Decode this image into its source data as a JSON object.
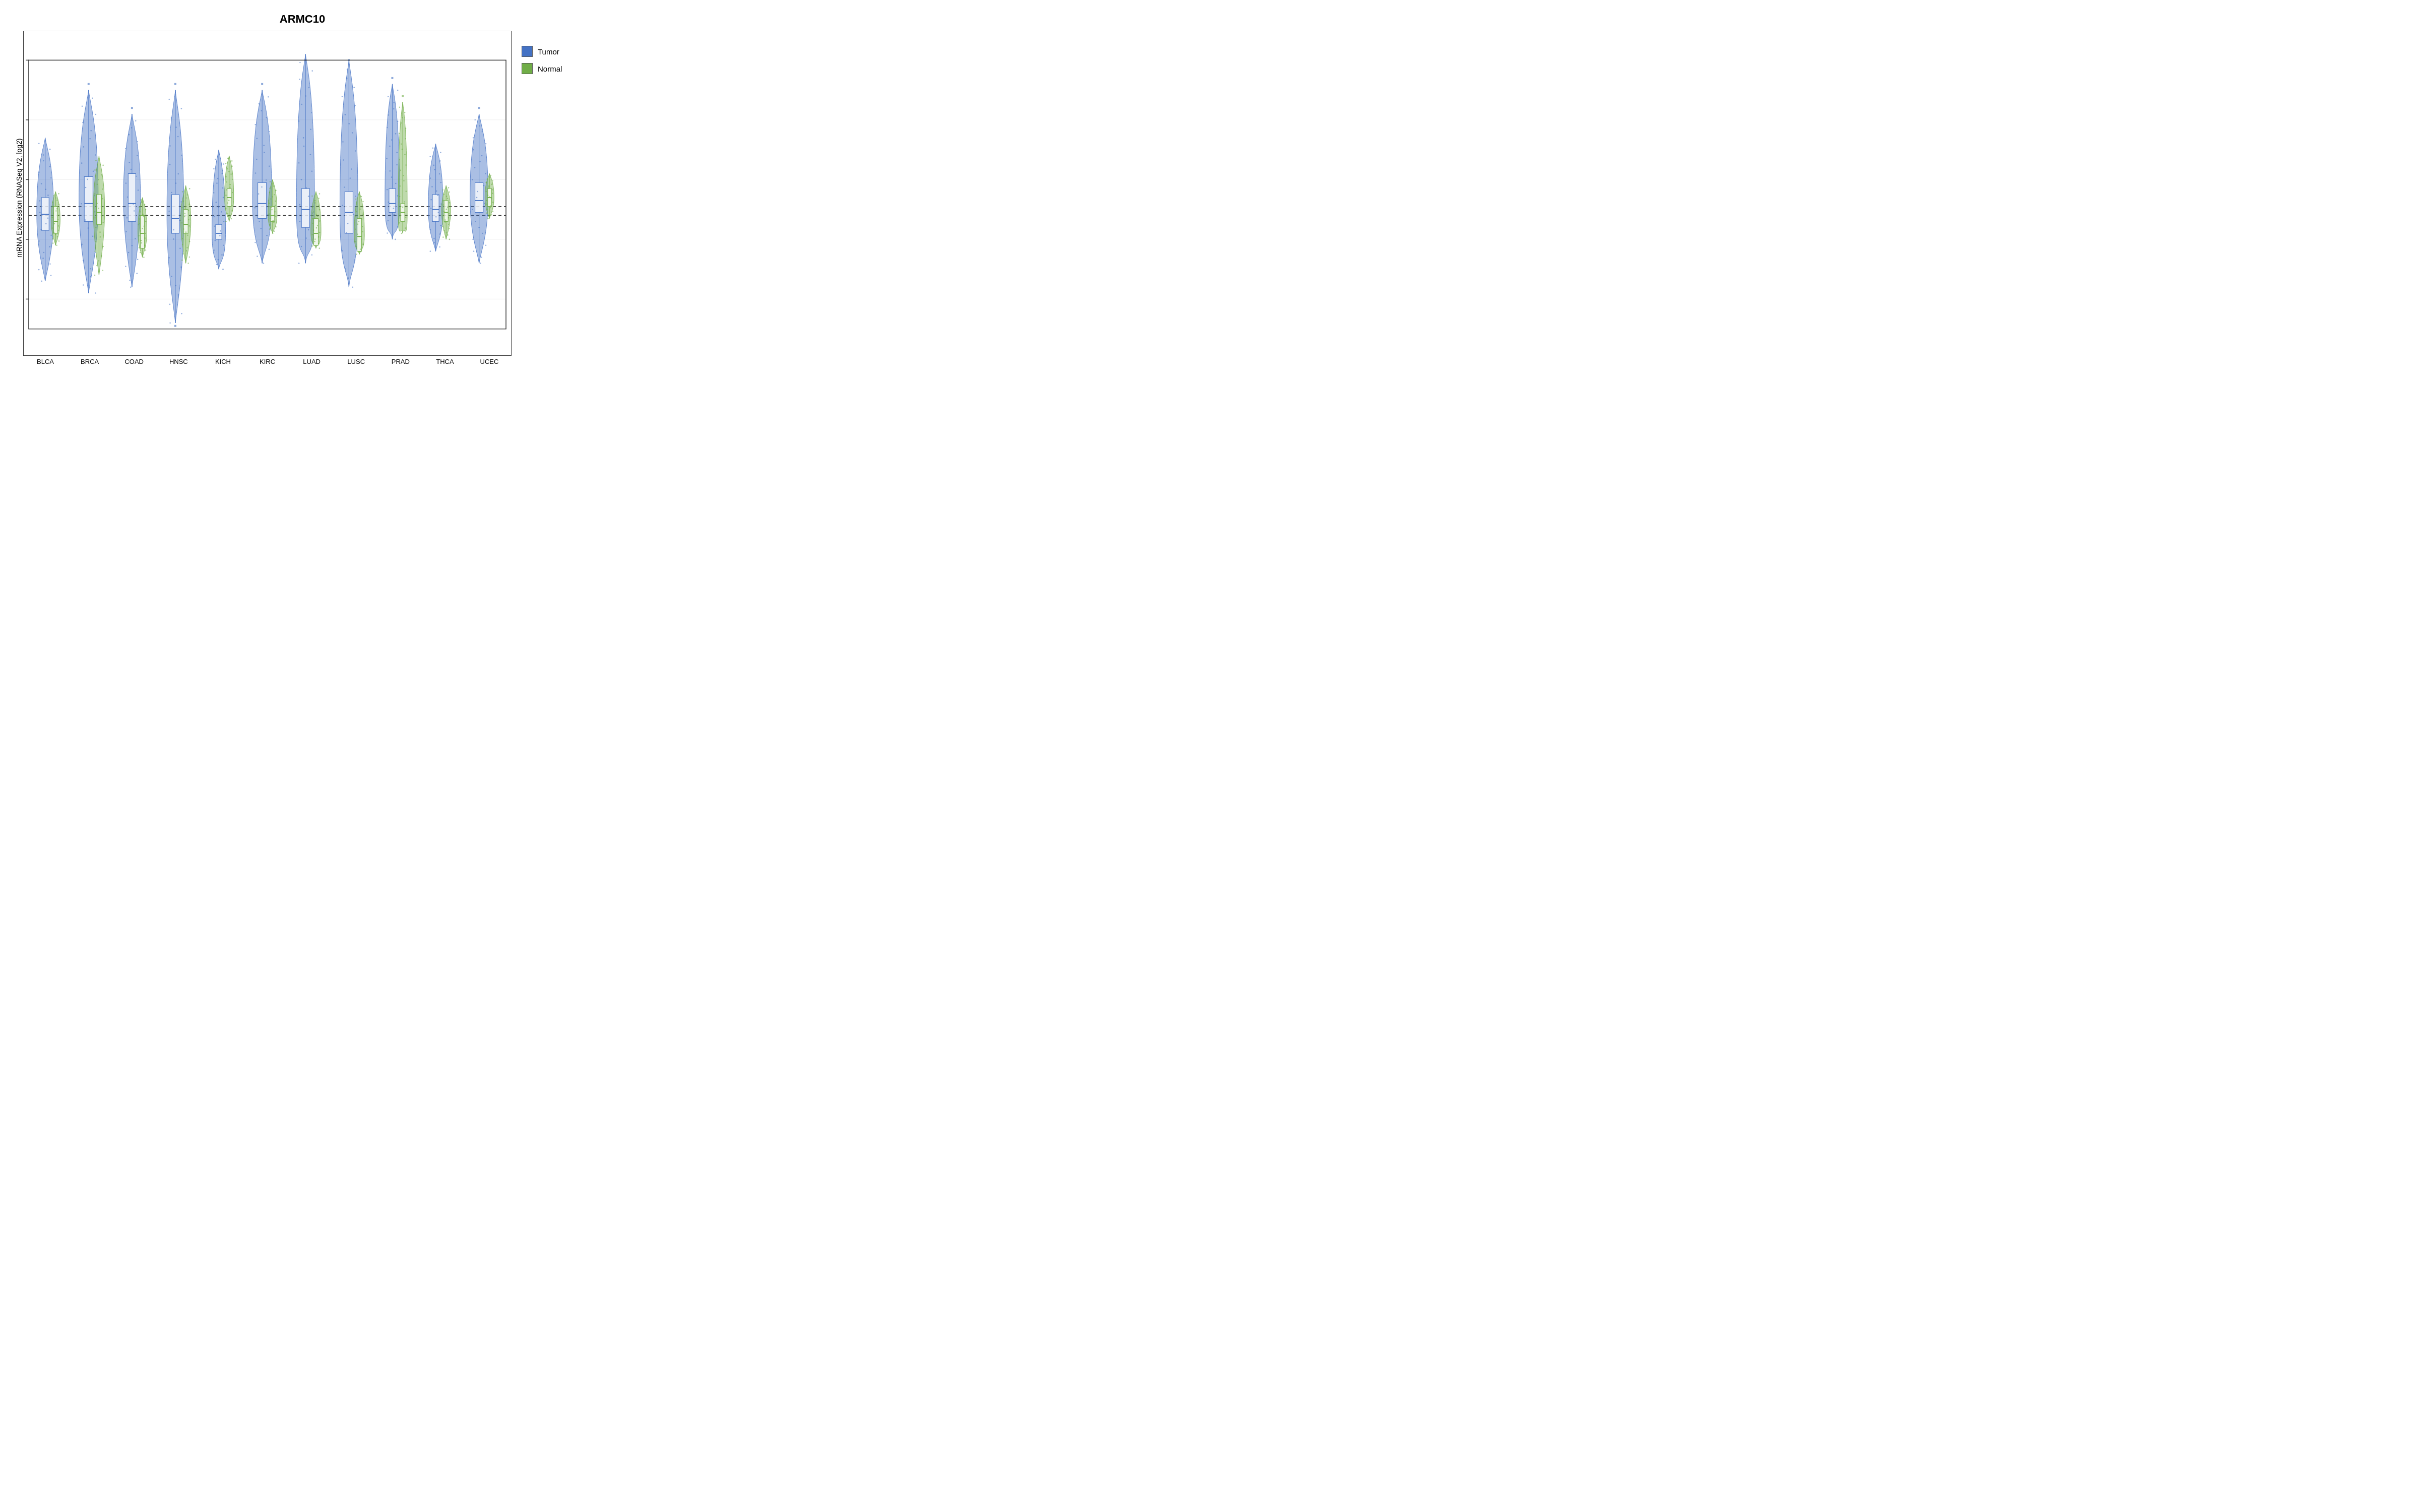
{
  "title": "ARMC10",
  "yAxisLabel": "mRNA Expression (RNASeq V2, log2)",
  "xLabels": [
    "BLCA",
    "BRCA",
    "COAD",
    "HNSC",
    "KICH",
    "KIRC",
    "LUAD",
    "LUSC",
    "PRAD",
    "THCA",
    "UCEC"
  ],
  "yAxis": {
    "min": 7.5,
    "max": 12,
    "ticks": [
      8,
      9,
      10,
      11,
      12
    ],
    "dottedLines": [
      9.4,
      9.55
    ]
  },
  "legend": {
    "items": [
      {
        "label": "Tumor",
        "color": "tumor"
      },
      {
        "label": "Normal",
        "color": "normal"
      }
    ]
  },
  "violins": [
    {
      "cancer": "BLCA",
      "tumor": {
        "cx": 0.5,
        "bottom": 8.3,
        "top": 10.7,
        "q1": 9.15,
        "q3": 9.7,
        "median": 9.42,
        "width": 0.28
      },
      "normal": {
        "cx": 0.5,
        "bottom": 8.9,
        "top": 9.8,
        "q1": 9.1,
        "q3": 9.55,
        "median": 9.3,
        "width": 0.14
      }
    },
    {
      "cancer": "BRCA",
      "tumor": {
        "cx": 1.5,
        "bottom": 8.1,
        "top": 11.5,
        "q1": 9.3,
        "q3": 10.05,
        "median": 9.6,
        "width": 0.32
      },
      "normal": {
        "cx": 1.5,
        "bottom": 8.4,
        "top": 10.4,
        "q1": 9.25,
        "q3": 9.75,
        "median": 9.45,
        "width": 0.18
      }
    },
    {
      "cancer": "COAD",
      "tumor": {
        "cx": 2.5,
        "bottom": 8.2,
        "top": 11.1,
        "q1": 9.3,
        "q3": 10.1,
        "median": 9.6,
        "width": 0.28
      },
      "normal": {
        "cx": 2.5,
        "bottom": 8.7,
        "top": 9.7,
        "q1": 8.85,
        "q3": 9.4,
        "median": 9.1,
        "width": 0.14
      }
    },
    {
      "cancer": "HNSC",
      "tumor": {
        "cx": 3.5,
        "bottom": 7.6,
        "top": 11.5,
        "q1": 9.1,
        "q3": 9.75,
        "median": 9.35,
        "width": 0.28
      },
      "normal": {
        "cx": 3.5,
        "bottom": 8.6,
        "top": 9.9,
        "q1": 9.1,
        "q3": 9.5,
        "median": 9.25,
        "width": 0.16
      }
    },
    {
      "cancer": "KICH",
      "tumor": {
        "cx": 4.5,
        "bottom": 8.5,
        "top": 10.5,
        "q1": 9.0,
        "q3": 9.25,
        "median": 9.1,
        "width": 0.22
      },
      "normal": {
        "cx": 4.5,
        "bottom": 9.3,
        "top": 10.4,
        "q1": 9.55,
        "q3": 9.85,
        "median": 9.7,
        "width": 0.14
      }
    },
    {
      "cancer": "KIRC",
      "tumor": {
        "cx": 5.5,
        "bottom": 8.6,
        "top": 11.5,
        "q1": 9.35,
        "q3": 9.95,
        "median": 9.6,
        "width": 0.32
      },
      "normal": {
        "cx": 5.5,
        "bottom": 9.1,
        "top": 10.0,
        "q1": 9.3,
        "q3": 9.55,
        "median": 9.4,
        "width": 0.14
      }
    },
    {
      "cancer": "LUAD",
      "tumor": {
        "cx": 6.5,
        "bottom": 8.6,
        "top": 12.1,
        "q1": 9.2,
        "q3": 9.85,
        "median": 9.5,
        "width": 0.3
      },
      "normal": {
        "cx": 6.5,
        "bottom": 8.85,
        "top": 9.8,
        "q1": 8.9,
        "q3": 9.35,
        "median": 9.1,
        "width": 0.16
      }
    },
    {
      "cancer": "LUSC",
      "tumor": {
        "cx": 7.5,
        "bottom": 8.2,
        "top": 12.0,
        "q1": 9.1,
        "q3": 9.8,
        "median": 9.45,
        "width": 0.3
      },
      "normal": {
        "cx": 7.5,
        "bottom": 8.75,
        "top": 9.8,
        "q1": 8.8,
        "q3": 9.35,
        "median": 9.05,
        "width": 0.16
      }
    },
    {
      "cancer": "PRAD",
      "tumor": {
        "cx": 8.5,
        "bottom": 9.0,
        "top": 11.6,
        "q1": 9.45,
        "q3": 9.85,
        "median": 9.6,
        "width": 0.24
      },
      "normal": {
        "cx": 8.5,
        "bottom": 9.1,
        "top": 11.3,
        "q1": 9.3,
        "q3": 9.6,
        "median": 9.45,
        "width": 0.14
      }
    },
    {
      "cancer": "THCA",
      "tumor": {
        "cx": 9.5,
        "bottom": 8.8,
        "top": 10.6,
        "q1": 9.3,
        "q3": 9.75,
        "median": 9.5,
        "width": 0.24
      },
      "normal": {
        "cx": 9.5,
        "bottom": 9.0,
        "top": 9.9,
        "q1": 9.3,
        "q3": 9.65,
        "median": 9.45,
        "width": 0.14
      }
    },
    {
      "cancer": "UCEC",
      "tumor": {
        "cx": 10.5,
        "bottom": 8.6,
        "top": 11.1,
        "q1": 9.45,
        "q3": 9.95,
        "median": 9.65,
        "width": 0.3
      },
      "normal": {
        "cx": 10.5,
        "bottom": 9.35,
        "top": 10.1,
        "q1": 9.55,
        "q3": 9.85,
        "median": 9.7,
        "width": 0.14
      }
    }
  ]
}
